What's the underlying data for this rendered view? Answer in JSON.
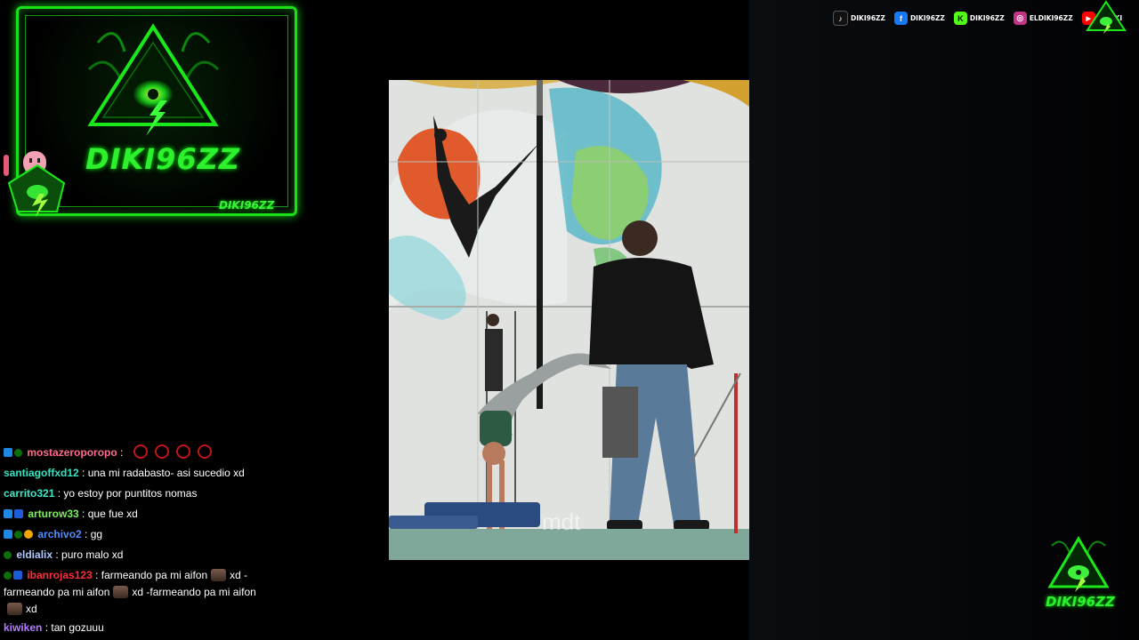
{
  "brand": {
    "logo_text": "DIKI96ZZ",
    "cam_caption": "DIKI96ZZ",
    "corner_text": "DIKI96ZZ",
    "accent": "#19e019"
  },
  "social": [
    {
      "icon": "tiktok-icon",
      "glyph": "♪",
      "color": "#111111",
      "label": "DIKI96ZZ"
    },
    {
      "icon": "facebook-icon",
      "glyph": "f",
      "color": "#1877f2",
      "label": "DIKI96ZZ"
    },
    {
      "icon": "kick-icon",
      "glyph": "K",
      "color": "#53fc18",
      "label": "DIKI96ZZ"
    },
    {
      "icon": "instagram-icon",
      "glyph": "◎",
      "color": "#c13584",
      "label": "ELDIKI96ZZ"
    },
    {
      "icon": "youtube-icon",
      "glyph": "▶",
      "color": "#ff0000",
      "label": "ELDIKI"
    }
  ],
  "video": {
    "watermark": "mdt"
  },
  "chat": [
    {
      "user": "mostazeroporopo",
      "color": "#ff6b8a",
      "text": "",
      "badges": [
        "prime",
        "green"
      ],
      "hearts": 4
    },
    {
      "user": "santiagoffxd12",
      "color": "#2ee6c2",
      "text": "una mi radabasto- asi sucedio xd",
      "badges": []
    },
    {
      "user": "carrito321",
      "color": "#3ee8c8",
      "text": "yo estoy por puntitos nomas",
      "badges": []
    },
    {
      "user": "arturow33",
      "color": "#7cf05a",
      "text": "que fue xd",
      "badges": [
        "prime",
        "sub"
      ]
    },
    {
      "user": "archivo2",
      "color": "#4f8cff",
      "text": "gg",
      "badges": [
        "prime",
        "green",
        "bits"
      ]
    },
    {
      "user": "eldialix",
      "color": "#b0c8ff",
      "text": "puro malo xd",
      "badges": [
        "green"
      ]
    },
    {
      "user": "ibanrojas123",
      "color": "#ff2d3a",
      "text_parts": [
        "farmeando pa mi aifon",
        "xd",
        "- farmeando pa mi aifon",
        "xd -farmeando pa mi aifon",
        "xd"
      ],
      "badges": [
        "green",
        "sub"
      ]
    },
    {
      "user": "kiwiken",
      "color": "#b37cff",
      "text": "tan gozuuu",
      "badges": []
    }
  ]
}
